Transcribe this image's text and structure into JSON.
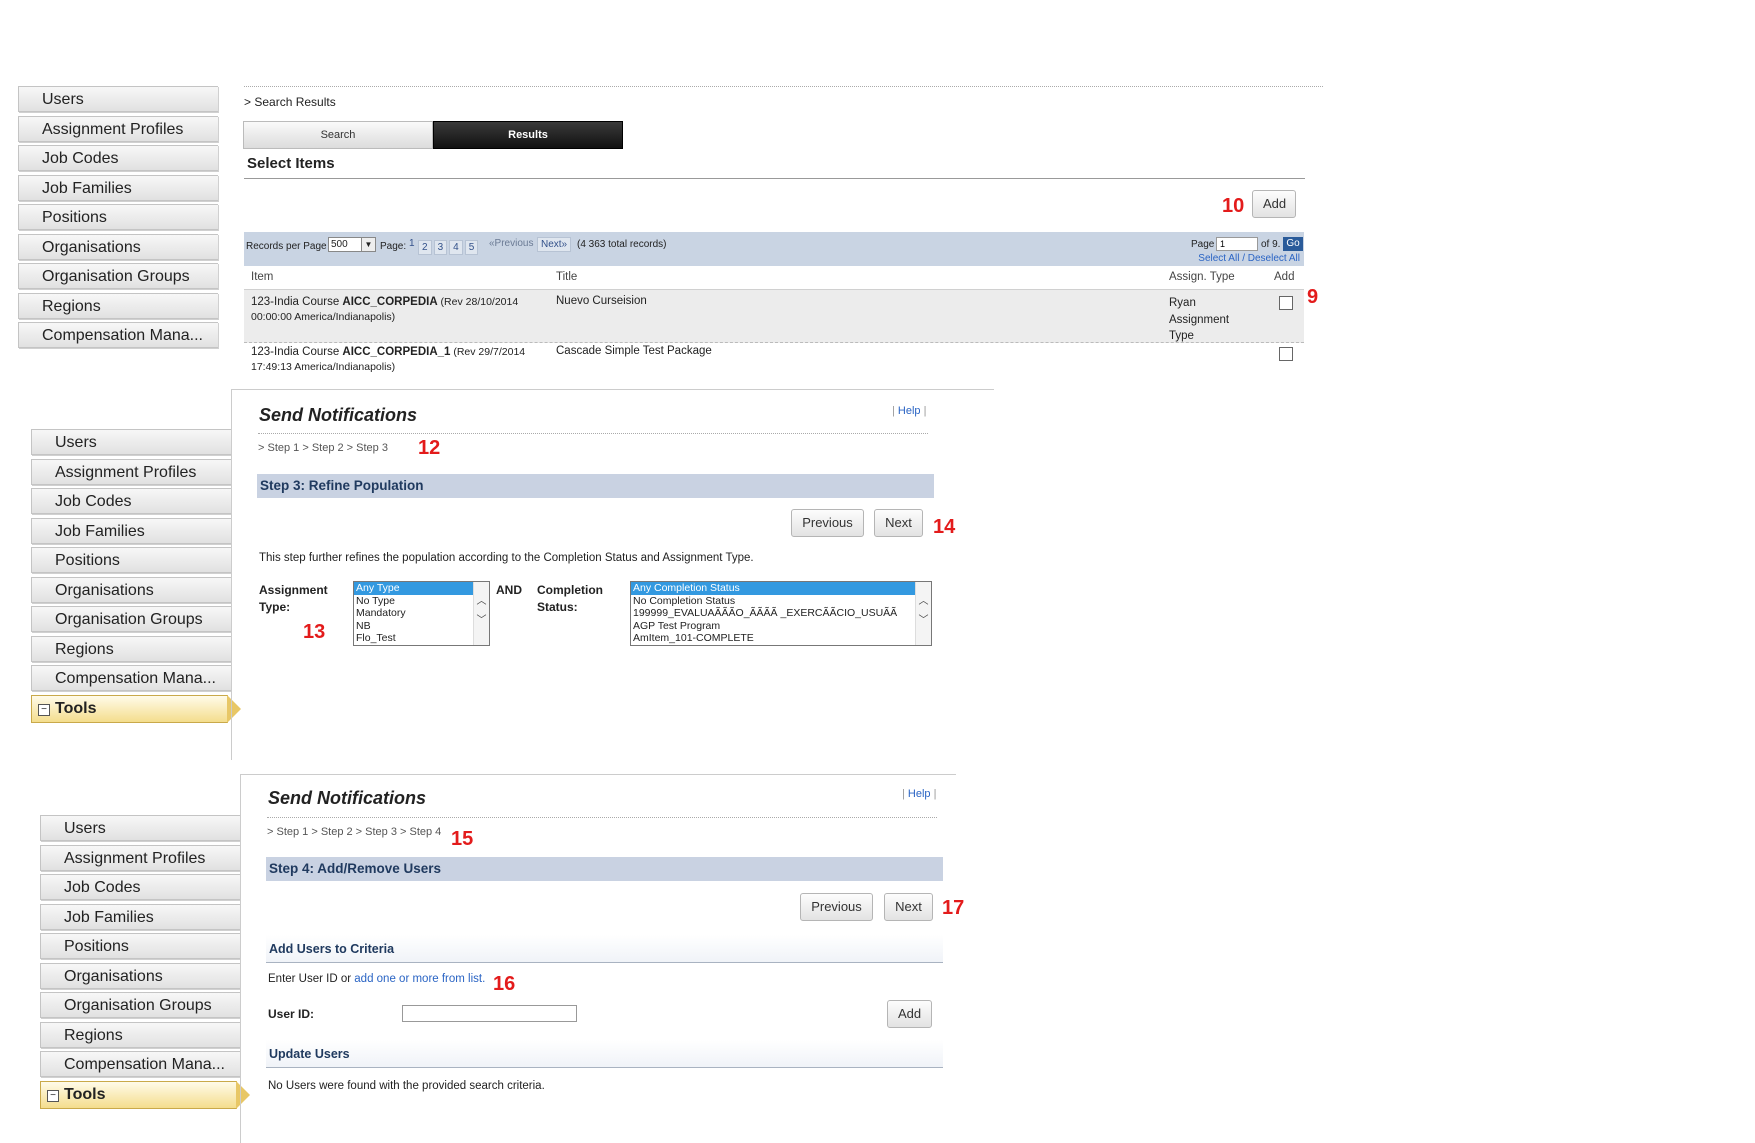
{
  "sidebar": {
    "items": [
      "Users",
      "Assignment Profiles",
      "Job Codes",
      "Job Families",
      "Positions",
      "Organisations",
      "Organisation Groups",
      "Regions",
      "Compensation Mana..."
    ],
    "tools_label": "Tools",
    "tools_toggle": "−"
  },
  "panel1": {
    "breadcrumb": "> Search Results",
    "tabs": {
      "search": "Search",
      "results": "Results"
    },
    "title": "Select Items",
    "add_label": "Add",
    "toolbar": {
      "records_label": "Records per Page",
      "records_value": "500",
      "records_arrow": "▼",
      "page_label": "Page:",
      "current_page": "1",
      "pages": [
        "2",
        "3",
        "4",
        "5"
      ],
      "previous": "«Previous",
      "next": "Next»",
      "total": "(4 363 total records)",
      "page_input_label": "Page",
      "page_input_value": "1",
      "of_pages": "of 9.",
      "go": "Go",
      "select_all": "Select All / Deselect All"
    },
    "columns": {
      "item": "Item",
      "title": "Title",
      "assign_type": "Assign. Type",
      "add": "Add"
    },
    "rows": [
      {
        "item_prefix": "123-India Course ",
        "item_bold": "AICC_CORPEDIA",
        "item_suffix": " (Rev 28/10/2014",
        "item_line2": "00:00:00 America/Indianapolis)",
        "title": "Nuevo Curseision",
        "assign": [
          "Ryan",
          "Assignment",
          "Type"
        ]
      },
      {
        "item_prefix": "123-India Course ",
        "item_bold": "AICC_CORPEDIA_1",
        "item_suffix": " (Rev 29/7/2014",
        "item_line2": "17:49:13 America/Indianapolis)",
        "title": "Cascade Simple Test Package",
        "assign": []
      }
    ]
  },
  "panel2": {
    "title": "Send Notifications",
    "help": "Help",
    "breadcrumb": "> Step 1 > Step 2 > Step 3",
    "step_title": "Step 3: Refine Population",
    "previous": "Previous",
    "next": "Next",
    "description": "This step further refines the population according to the Completion Status and Assignment Type.",
    "assign_type_label": "Assignment Type:",
    "and_label": "AND",
    "completion_label": "Completion Status:",
    "assign_options": [
      "Any Type",
      "No Type",
      "Mandatory",
      "NB",
      "Flo_Test"
    ],
    "completion_options": [
      "Any Completion Status",
      "No Completion Status",
      "199999_EVALUAÃÃÃO_ÃÃÃÃ _EXERCÃÃCIO_USUÃÃ",
      "AGP Test Program",
      "AmItem_101-COMPLETE"
    ]
  },
  "panel3": {
    "title": "Send Notifications",
    "help": "Help",
    "breadcrumb": "> Step 1 > Step 2 > Step 3 > Step 4",
    "step_title": "Step 4: Add/Remove Users",
    "previous": "Previous",
    "next": "Next",
    "add_users_header": "Add Users to Criteria",
    "enter_text": "Enter User ID or ",
    "enter_link": "add one or more from list.",
    "user_id_label": "User ID:",
    "user_id_value": "",
    "add_label": "Add",
    "update_header": "Update Users",
    "no_users": "No Users were found with the provided search criteria."
  },
  "annotations": {
    "a9": "9",
    "a10": "10",
    "a12": "12",
    "a13": "13",
    "a14": "14",
    "a15": "15",
    "a16": "16",
    "a17": "17"
  },
  "colors": {
    "annotation": "#e31b1b",
    "toolbar": "#c9d4e3",
    "link": "#2a64c4",
    "selected": "#3399e0",
    "tools_accent": "#f4dd8d"
  }
}
